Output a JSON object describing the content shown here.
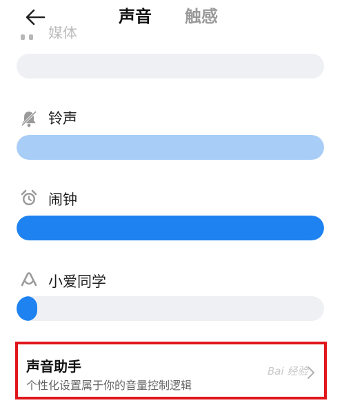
{
  "header": {
    "tab_sound": "声音",
    "tab_haptic": "触感"
  },
  "rows": [
    {
      "label": "媒体",
      "icon": "media-icon",
      "level": 0.0,
      "fill_color": "#1e82f0"
    },
    {
      "label": "铃声",
      "icon": "bell-muted-icon",
      "level": 1.0,
      "fill_color": "#a8cdf7"
    },
    {
      "label": "闹钟",
      "icon": "alarm-clock-icon",
      "level": 1.0,
      "fill_color": "#1e82f0"
    },
    {
      "label": "小爱同学",
      "icon": "xiaoai-icon",
      "level": 0.06,
      "fill_color": "#1e82f0"
    }
  ],
  "assistant": {
    "title": "声音助手",
    "subtitle": "个性化设置属于你的音量控制逻辑"
  },
  "watermark": "Bai 经验",
  "colors": {
    "track": "#eef0f3",
    "accent": "#1e82f0",
    "highlight_border": "#e0161b"
  }
}
